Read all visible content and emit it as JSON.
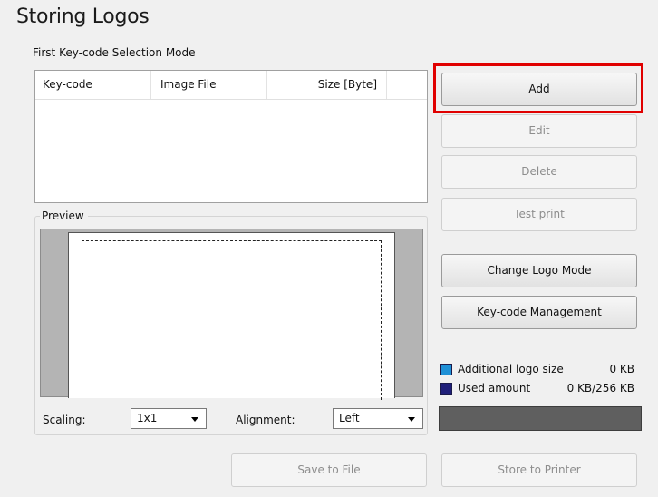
{
  "title": "Storing Logos",
  "subtitle": "First Key-code Selection Mode",
  "table": {
    "columns": [
      "Key-code",
      "Image File",
      "Size [Byte]"
    ],
    "rows": []
  },
  "preview": {
    "legend": "Preview",
    "scaling_label": "Scaling:",
    "scaling_value": "1x1",
    "alignment_label": "Alignment:",
    "alignment_value": "Left"
  },
  "buttons": {
    "add": "Add",
    "edit": "Edit",
    "delete": "Delete",
    "test_print": "Test print",
    "change_logo_mode": "Change Logo Mode",
    "keycode_management": "Key-code Management",
    "save_to_file": "Save to File",
    "store_to_printer": "Store to Printer"
  },
  "usage": {
    "additional_label": "Additional logo size",
    "additional_value": "0 KB",
    "used_label": "Used amount",
    "used_value": "0 KB/256 KB",
    "additional_color": "#1e90d6",
    "used_color": "#1f1f7a"
  }
}
